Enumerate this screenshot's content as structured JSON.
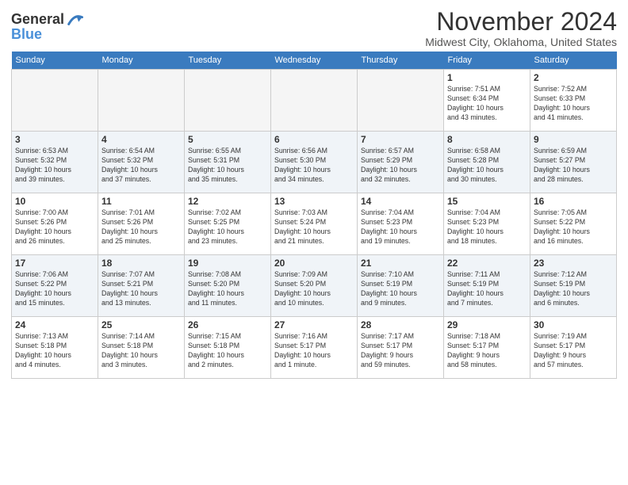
{
  "header": {
    "logo_line1": "General",
    "logo_line2": "Blue",
    "month_title": "November 2024",
    "location": "Midwest City, Oklahoma, United States"
  },
  "weekdays": [
    "Sunday",
    "Monday",
    "Tuesday",
    "Wednesday",
    "Thursday",
    "Friday",
    "Saturday"
  ],
  "rows": [
    [
      {
        "day": "",
        "text": ""
      },
      {
        "day": "",
        "text": ""
      },
      {
        "day": "",
        "text": ""
      },
      {
        "day": "",
        "text": ""
      },
      {
        "day": "",
        "text": ""
      },
      {
        "day": "1",
        "text": "Sunrise: 7:51 AM\nSunset: 6:34 PM\nDaylight: 10 hours\nand 43 minutes."
      },
      {
        "day": "2",
        "text": "Sunrise: 7:52 AM\nSunset: 6:33 PM\nDaylight: 10 hours\nand 41 minutes."
      }
    ],
    [
      {
        "day": "3",
        "text": "Sunrise: 6:53 AM\nSunset: 5:32 PM\nDaylight: 10 hours\nand 39 minutes."
      },
      {
        "day": "4",
        "text": "Sunrise: 6:54 AM\nSunset: 5:32 PM\nDaylight: 10 hours\nand 37 minutes."
      },
      {
        "day": "5",
        "text": "Sunrise: 6:55 AM\nSunset: 5:31 PM\nDaylight: 10 hours\nand 35 minutes."
      },
      {
        "day": "6",
        "text": "Sunrise: 6:56 AM\nSunset: 5:30 PM\nDaylight: 10 hours\nand 34 minutes."
      },
      {
        "day": "7",
        "text": "Sunrise: 6:57 AM\nSunset: 5:29 PM\nDaylight: 10 hours\nand 32 minutes."
      },
      {
        "day": "8",
        "text": "Sunrise: 6:58 AM\nSunset: 5:28 PM\nDaylight: 10 hours\nand 30 minutes."
      },
      {
        "day": "9",
        "text": "Sunrise: 6:59 AM\nSunset: 5:27 PM\nDaylight: 10 hours\nand 28 minutes."
      }
    ],
    [
      {
        "day": "10",
        "text": "Sunrise: 7:00 AM\nSunset: 5:26 PM\nDaylight: 10 hours\nand 26 minutes."
      },
      {
        "day": "11",
        "text": "Sunrise: 7:01 AM\nSunset: 5:26 PM\nDaylight: 10 hours\nand 25 minutes."
      },
      {
        "day": "12",
        "text": "Sunrise: 7:02 AM\nSunset: 5:25 PM\nDaylight: 10 hours\nand 23 minutes."
      },
      {
        "day": "13",
        "text": "Sunrise: 7:03 AM\nSunset: 5:24 PM\nDaylight: 10 hours\nand 21 minutes."
      },
      {
        "day": "14",
        "text": "Sunrise: 7:04 AM\nSunset: 5:23 PM\nDaylight: 10 hours\nand 19 minutes."
      },
      {
        "day": "15",
        "text": "Sunrise: 7:04 AM\nSunset: 5:23 PM\nDaylight: 10 hours\nand 18 minutes."
      },
      {
        "day": "16",
        "text": "Sunrise: 7:05 AM\nSunset: 5:22 PM\nDaylight: 10 hours\nand 16 minutes."
      }
    ],
    [
      {
        "day": "17",
        "text": "Sunrise: 7:06 AM\nSunset: 5:22 PM\nDaylight: 10 hours\nand 15 minutes."
      },
      {
        "day": "18",
        "text": "Sunrise: 7:07 AM\nSunset: 5:21 PM\nDaylight: 10 hours\nand 13 minutes."
      },
      {
        "day": "19",
        "text": "Sunrise: 7:08 AM\nSunset: 5:20 PM\nDaylight: 10 hours\nand 11 minutes."
      },
      {
        "day": "20",
        "text": "Sunrise: 7:09 AM\nSunset: 5:20 PM\nDaylight: 10 hours\nand 10 minutes."
      },
      {
        "day": "21",
        "text": "Sunrise: 7:10 AM\nSunset: 5:19 PM\nDaylight: 10 hours\nand 9 minutes."
      },
      {
        "day": "22",
        "text": "Sunrise: 7:11 AM\nSunset: 5:19 PM\nDaylight: 10 hours\nand 7 minutes."
      },
      {
        "day": "23",
        "text": "Sunrise: 7:12 AM\nSunset: 5:19 PM\nDaylight: 10 hours\nand 6 minutes."
      }
    ],
    [
      {
        "day": "24",
        "text": "Sunrise: 7:13 AM\nSunset: 5:18 PM\nDaylight: 10 hours\nand 4 minutes."
      },
      {
        "day": "25",
        "text": "Sunrise: 7:14 AM\nSunset: 5:18 PM\nDaylight: 10 hours\nand 3 minutes."
      },
      {
        "day": "26",
        "text": "Sunrise: 7:15 AM\nSunset: 5:18 PM\nDaylight: 10 hours\nand 2 minutes."
      },
      {
        "day": "27",
        "text": "Sunrise: 7:16 AM\nSunset: 5:17 PM\nDaylight: 10 hours\nand 1 minute."
      },
      {
        "day": "28",
        "text": "Sunrise: 7:17 AM\nSunset: 5:17 PM\nDaylight: 9 hours\nand 59 minutes."
      },
      {
        "day": "29",
        "text": "Sunrise: 7:18 AM\nSunset: 5:17 PM\nDaylight: 9 hours\nand 58 minutes."
      },
      {
        "day": "30",
        "text": "Sunrise: 7:19 AM\nSunset: 5:17 PM\nDaylight: 9 hours\nand 57 minutes."
      }
    ]
  ]
}
